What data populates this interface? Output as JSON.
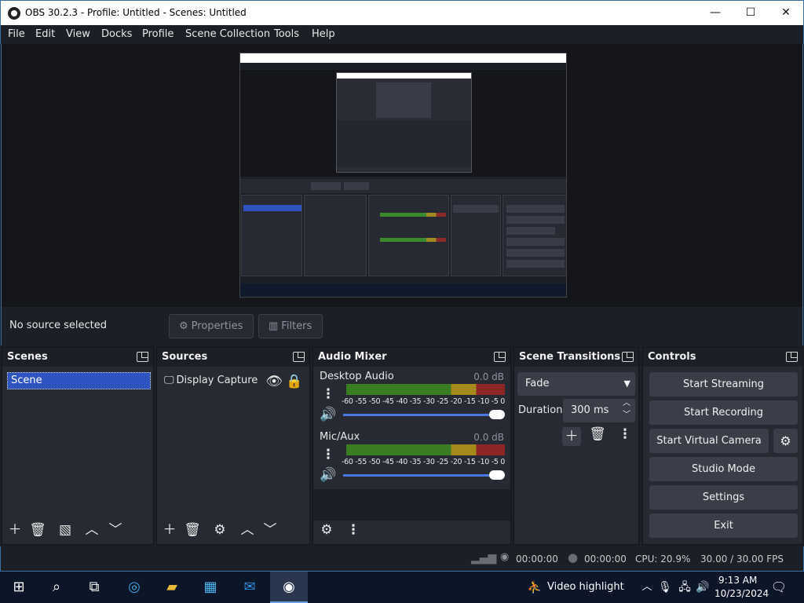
{
  "window": {
    "title": "OBS 30.2.3 - Profile: Untitled - Scenes: Untitled",
    "minimize": "—",
    "maximize": "☐",
    "close": "✕"
  },
  "menu": [
    "File",
    "Edit",
    "View",
    "Docks",
    "Profile",
    "Scene Collection",
    "Tools",
    "Help"
  ],
  "source_bar": {
    "status": "No source selected",
    "properties": "Properties",
    "filters": "Filters"
  },
  "scenes": {
    "title": "Scenes",
    "items": [
      "Scene"
    ]
  },
  "sources": {
    "title": "Sources",
    "items": [
      "Display Capture"
    ]
  },
  "mixer": {
    "title": "Audio Mixer",
    "ticks": "-60 -55 -50 -45 -40 -35 -30 -25 -20 -15 -10  -5  0",
    "tracks": [
      {
        "name": "Desktop Audio",
        "db": "0.0 dB"
      },
      {
        "name": "Mic/Aux",
        "db": "0.0 dB"
      }
    ]
  },
  "transitions": {
    "title": "Scene Transitions",
    "selected": "Fade",
    "duration_label": "Duration",
    "duration_value": "300 ms"
  },
  "controls": {
    "title": "Controls",
    "start_streaming": "Start Streaming",
    "start_recording": "Start Recording",
    "start_virtual_camera": "Start Virtual Camera",
    "studio_mode": "Studio Mode",
    "settings": "Settings",
    "exit": "Exit"
  },
  "status": {
    "stream_time": "00:00:00",
    "record_time": "00:00:00",
    "cpu": "CPU: 20.9%",
    "fps": "30.00 / 30.00 FPS"
  },
  "taskbar": {
    "notification": "Video highlight",
    "time": "9:13 AM",
    "date": "10/23/2024"
  },
  "colors": {
    "accent": "#2f54c2",
    "dock_bg": "#272a33",
    "window_bg": "#1d1f26",
    "taskbar_bg": "#0b1628"
  }
}
